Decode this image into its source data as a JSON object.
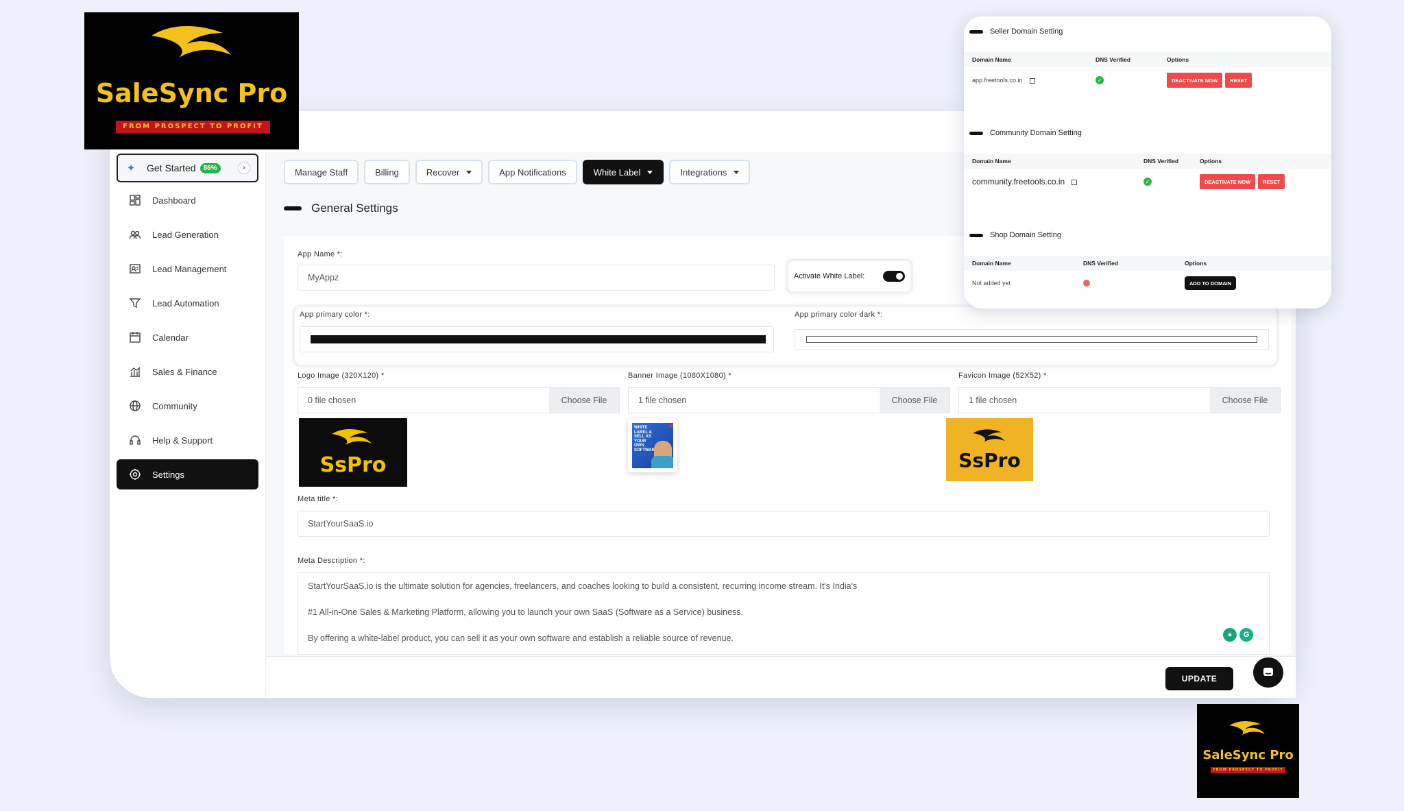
{
  "brand": {
    "name": "SaleSync Pro",
    "tagline": "FROM PROSPECT TO PROFIT",
    "short": "SsPro",
    "gold": "#f3c11b",
    "red": "#c4141b"
  },
  "sidebar": {
    "get_started": {
      "label": "Get Started",
      "progress": "86%"
    },
    "items": [
      {
        "label": "Dashboard",
        "icon": "dashboard-icon"
      },
      {
        "label": "Lead Generation",
        "icon": "users-icon"
      },
      {
        "label": "Lead Management",
        "icon": "id-card-icon"
      },
      {
        "label": "Lead Automation",
        "icon": "funnel-icon"
      },
      {
        "label": "Calendar",
        "icon": "calendar-icon"
      },
      {
        "label": "Sales & Finance",
        "icon": "chart-icon"
      },
      {
        "label": "Community",
        "icon": "globe-icon"
      },
      {
        "label": "Help & Support",
        "icon": "headset-icon"
      },
      {
        "label": "Settings",
        "icon": "gear-icon",
        "active": true
      }
    ]
  },
  "tabs": [
    {
      "label": "Manage Staff"
    },
    {
      "label": "Billing"
    },
    {
      "label": "Recover",
      "dropdown": true
    },
    {
      "label": "App Notifications"
    },
    {
      "label": "White Label",
      "dropdown": true,
      "active": true
    },
    {
      "label": "Integrations",
      "dropdown": true
    }
  ],
  "general": {
    "title": "General Settings",
    "app_name_label": "App Name *:",
    "app_name_value": "MyAppz",
    "activate_label": "Activate White Label:",
    "primary_color_label": "App primary color *:",
    "primary_color_value": "#111111",
    "primary_dark_label": "App primary color dark *:",
    "logo_label": "Logo Image (320X120) *",
    "logo_file": "0 file chosen",
    "banner_label": "Banner Image (1080X1080) *",
    "banner_file": "1 file chosen",
    "favicon_label": "Favicon Image (52X52) *",
    "favicon_file": "1 file chosen",
    "choose_file": "Choose File",
    "banner_thumb_text": "WHITE LABEL & SELL AS YOUR OWN SOFTWARE",
    "meta_title_label": "Meta title *:",
    "meta_title_value": "StartYourSaaS.io",
    "meta_desc_label": "Meta Description *:",
    "meta_desc_lines": [
      "StartYourSaaS.io is the ultimate solution for agencies, freelancers, and coaches looking to build a consistent, recurring income stream. It's India's",
      "#1 All-in-One Sales & Marketing Platform, allowing you to launch your own SaaS (Software as a Service) business.",
      "By offering a white-label product, you can sell it as your own software and establish a reliable source of revenue."
    ],
    "update": "UPDATE"
  },
  "domains": {
    "seller": {
      "title": "Seller Domain Setting",
      "headers": [
        "Domain Name",
        "DNS Verified",
        "Options"
      ],
      "domain": "app.freetools.co.in",
      "deactivate": "DEACTIVATE NOW",
      "reset": "RESET"
    },
    "community": {
      "title": "Community Domain Setting",
      "headers": [
        "Domain Name",
        "DNS Verified",
        "Options"
      ],
      "domain": "community.freetools.co.in",
      "deactivate": "DEACTIVATE NOW",
      "reset": "RESET"
    },
    "shop": {
      "title": "Shop Domain Setting",
      "headers": [
        "Domain Name",
        "DNS Verified",
        "Options"
      ],
      "domain": "Not added yet",
      "add": "ADD TO DOMAIN"
    }
  }
}
